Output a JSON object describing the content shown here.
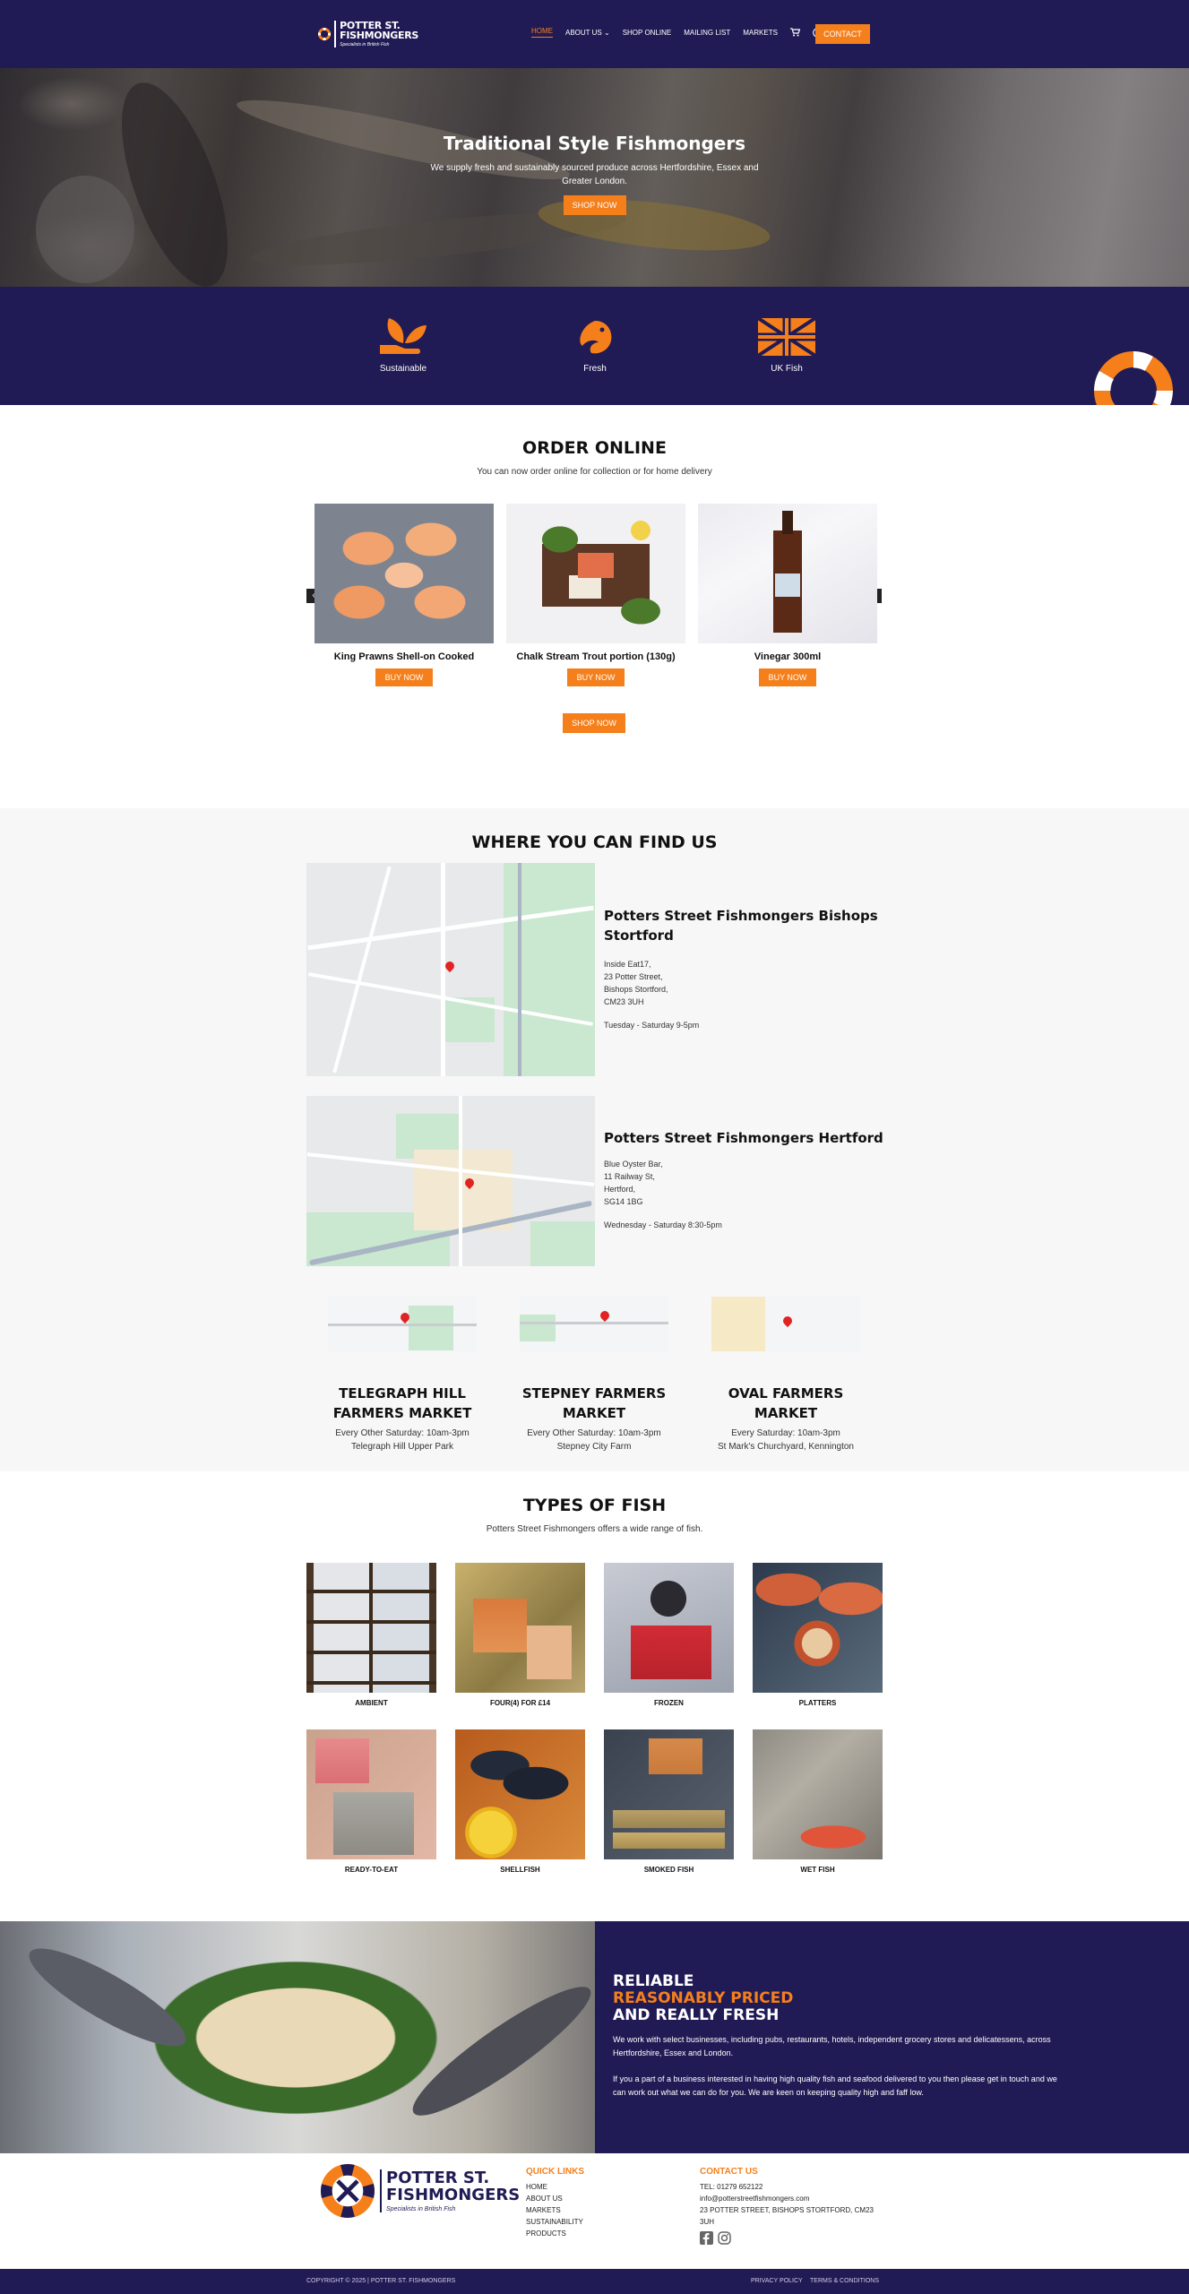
{
  "brand": {
    "name_line1": "POTTER ST.",
    "name_line2": "FISHMONGERS",
    "tagline": "Specialists in British Fish",
    "orange": "#f57f1b",
    "navy": "#211b55"
  },
  "nav": {
    "items": [
      "HOME",
      "ABOUT US",
      "SHOP ONLINE",
      "MAILING LIST",
      "MARKETS"
    ],
    "about_caret": "⌄",
    "cart_icon": "cart-icon",
    "account_icon": "account-icon",
    "contact_label": "CONTACT"
  },
  "hero": {
    "title": "Traditional Style Fishmongers",
    "subtitle": "We supply fresh and sustainably sourced produce across Hertfordshire, Essex and Greater London.",
    "button": "SHOP NOW"
  },
  "features": [
    {
      "label": "Sustainable",
      "icon": "leaf-hand-icon"
    },
    {
      "label": "Fresh",
      "icon": "fish-icon"
    },
    {
      "label": "UK Fish",
      "icon": "union-jack-icon"
    }
  ],
  "order": {
    "title": "ORDER ONLINE",
    "subtitle": "You can now order online for collection or for home delivery",
    "products": [
      {
        "name": "King Prawns Shell-on Cooked",
        "button": "BUY NOW"
      },
      {
        "name": "Chalk Stream Trout portion (130g)",
        "button": "BUY NOW"
      },
      {
        "name": "Vinegar 300ml",
        "button": "BUY NOW"
      }
    ],
    "shop_button": "SHOP NOW",
    "prev": "‹",
    "next": "›"
  },
  "findus": {
    "title": "WHERE YOU CAN FIND US",
    "locations": [
      {
        "name": "Potters Street Fishmongers Bishops Stortford",
        "address": [
          "Inside Eat17,",
          "23 Potter Street,",
          "Bishops Stortford,",
          "CM23 3UH"
        ],
        "hours": "Tuesday - Saturday 9-5pm"
      },
      {
        "name": "Potters Street Fishmongers Hertford",
        "address": [
          "Blue Oyster Bar,",
          "11 Railway St,",
          "Hertford,",
          "SG14 1BG"
        ],
        "hours": "Wednesday - Saturday 8:30-5pm"
      }
    ],
    "markets": [
      {
        "name": "TELEGRAPH HILL FARMERS MARKET",
        "when": "Every Other Saturday: 10am-3pm",
        "where": "Telegraph Hill Upper Park"
      },
      {
        "name": "STEPNEY FARMERS MARKET",
        "when": "Every Other Saturday: 10am-3pm",
        "where": "Stepney City Farm"
      },
      {
        "name": "OVAL FARMERS MARKET",
        "when": "Every Saturday: 10am-3pm",
        "where": "St Mark's Churchyard, Kennington"
      }
    ]
  },
  "types": {
    "title": "TYPES OF FISH",
    "subtitle": "Potters Street Fishmongers offers a wide range of fish.",
    "tiles": [
      "AMBIENT",
      "FOUR(4) FOR £14",
      "FROZEN",
      "PLATTERS",
      "READY-TO-EAT",
      "SHELLFISH",
      "SMOKED FISH",
      "WET FISH"
    ]
  },
  "reliable": {
    "line1": "RELIABLE",
    "line2": "REASONABLY PRICED",
    "line3": "AND REALLY FRESH",
    "para1": "We work with select businesses, including pubs, restaurants, hotels, independent grocery stores and delicatessens, across Hertfordshire, Essex and London.",
    "para2": "If you a part of a business interested in having high quality fish and seafood delivered to you then please get in touch and we can work out what we can do for you. We are keen on keeping quality high and faff low."
  },
  "footer": {
    "quick_links_title": "QUICK LINKS",
    "quick_links": [
      "HOME",
      "ABOUT US",
      "MARKETS",
      "SUSTAINABILITY",
      "PRODUCTS"
    ],
    "contact_title": "CONTACT US",
    "tel": "TEL: 01279 652122",
    "email": "info@potterstreetfishmongers.com",
    "address": "23 POTTER STREET, BISHOPS STORTFORD, CM23 3UH",
    "copyright": "COPYRIGHT © 2025 | POTTER ST. FISHMONGERS",
    "privacy": "PRIVACY POLICY",
    "terms": "TERMS & CONDITIONS"
  }
}
